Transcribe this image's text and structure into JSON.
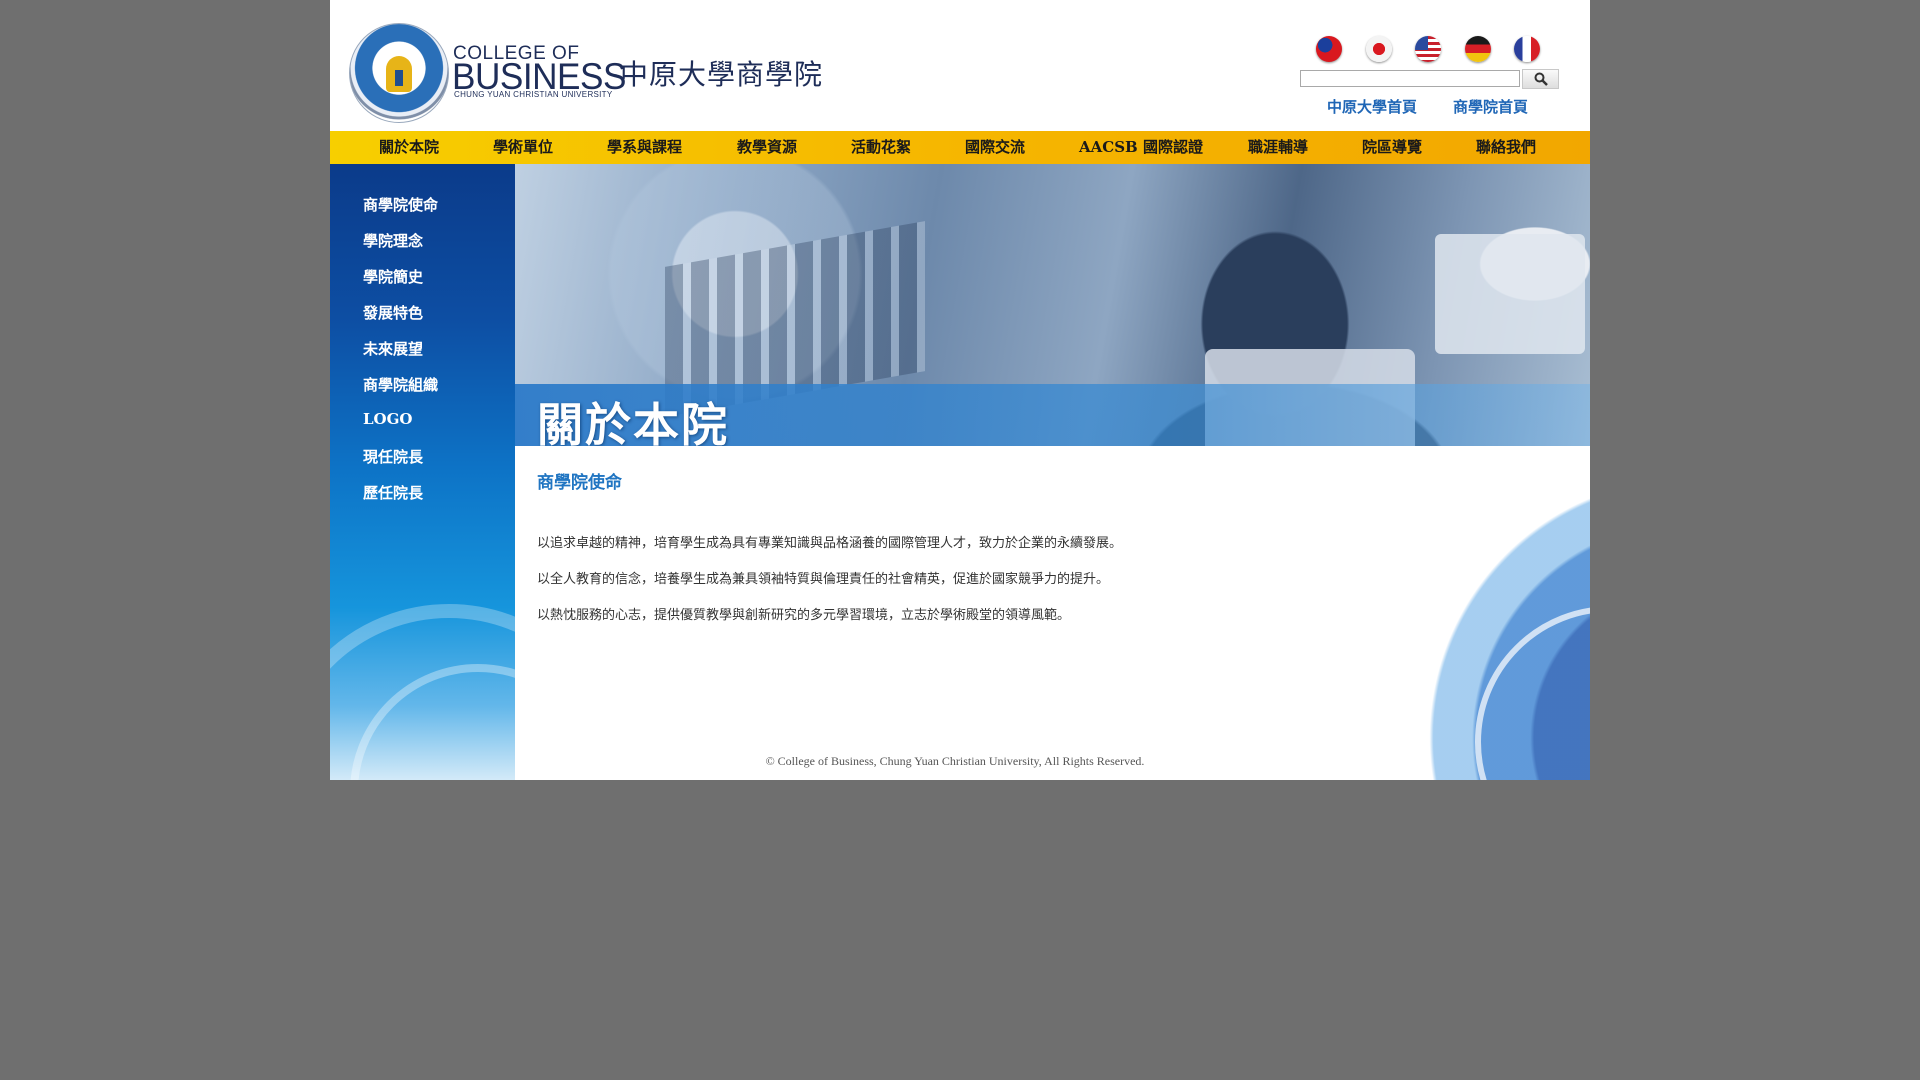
{
  "header": {
    "logo_college": "COLLEGE OF",
    "logo_business": "BUSINESS",
    "logo_university_en": "CHUNG YUAN CHRISTIAN UNIVERSITY",
    "logo_chinese": "中原大學商學院",
    "links": {
      "cycu_home": "中原大學首頁",
      "cob_home": "商學院首頁"
    },
    "search": {
      "placeholder": ""
    },
    "flags": [
      "flag-taiwan-icon",
      "flag-japan-icon",
      "flag-usa-icon",
      "flag-germany-icon",
      "flag-france-icon"
    ]
  },
  "nav": {
    "items": [
      "關於本院",
      "學術單位",
      "學系與課程",
      "教學資源",
      "活動花絮",
      "國際交流",
      "AACSB 國際認證",
      "職涯輔導",
      "院區導覽",
      "聯絡我們"
    ]
  },
  "sidebar": {
    "items": [
      "商學院使命",
      "學院理念",
      "學院簡史",
      "發展特色",
      "未來展望",
      "商學院組織",
      "LOGO",
      "現任院長",
      "歷任院長"
    ]
  },
  "banner": {
    "title": "關於本院"
  },
  "content": {
    "section_title": "商學院使命",
    "paragraphs": [
      "以追求卓越的精神，培育學生成為具有專業知識與品格涵養的國際管理人才，致力於企業的永續發展。",
      "以全人教育的信念，培養學生成為兼具領袖特質與倫理責任的社會精英，促進於國家競爭力的提升。",
      "以熱忱服務的心志，提供優質教學與創新研究的多元學習環境，立志於學術殿堂的領導風範。"
    ]
  },
  "footer": {
    "copyright": "© College of Business, Chung Yuan Christian University, All Rights Reserved."
  },
  "colors": {
    "background": "#6f6f6f",
    "nav_bar": "#f6b800",
    "sidebar": "#0d4ea3",
    "accent_link": "#1f66b6"
  }
}
